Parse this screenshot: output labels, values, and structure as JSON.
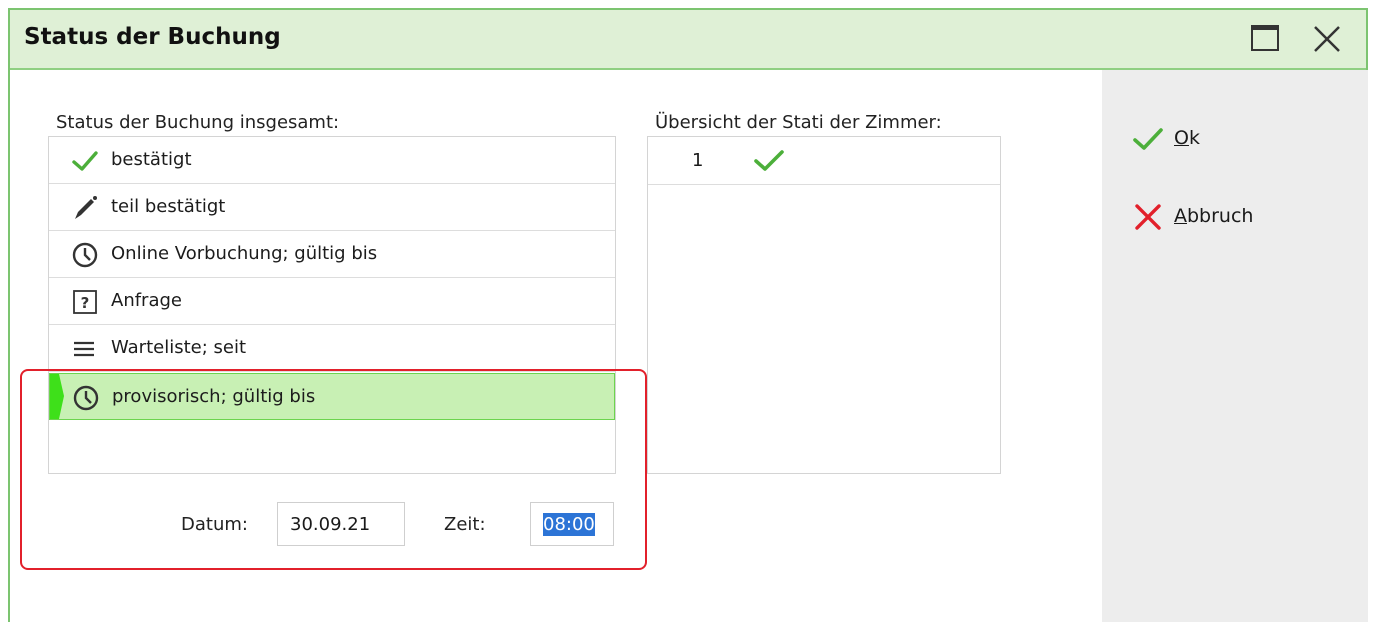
{
  "window": {
    "title": "Status der Buchung"
  },
  "overall": {
    "label": "Status der Buchung insgesamt:",
    "items": [
      {
        "label": "bestätigt",
        "icon": "check-icon"
      },
      {
        "label": "teil bestätigt",
        "icon": "pen-icon"
      },
      {
        "label": "Online Vorbuchung; gültig bis",
        "icon": "clock-icon"
      },
      {
        "label": "Anfrage",
        "icon": "question-box-icon"
      },
      {
        "label": "Warteliste; seit",
        "icon": "list-icon"
      },
      {
        "label": "provisorisch; gültig bis",
        "icon": "clock-icon",
        "selected": true
      }
    ]
  },
  "rooms": {
    "label": "Übersicht der Stati der Zimmer:",
    "rows": [
      {
        "number": "1",
        "status_icon": "check-icon"
      }
    ]
  },
  "validity": {
    "date_label": "Datum:",
    "date_value": "30.09.21",
    "time_label": "Zeit:",
    "time_value": "08:00"
  },
  "actions": {
    "ok_underlined": "O",
    "ok_rest": "k",
    "cancel_underlined": "A",
    "cancel_rest": "bbruch"
  },
  "colors": {
    "title_bar": "#dff0d6",
    "border": "#7cc470",
    "check": "#4caf3a",
    "cancel": "#e2202b",
    "selected_row": "#c8f0b4",
    "highlight": "#e2202b",
    "selection_text_bg": "#2c74d6"
  }
}
